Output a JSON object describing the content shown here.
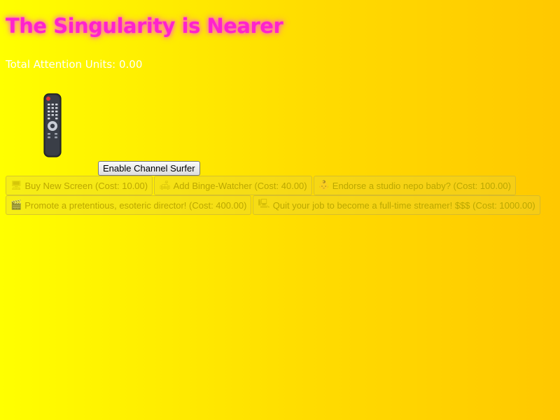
{
  "header": {
    "title": "The Singularity is Nearer",
    "score_text": "Total Attention Units: 0.00"
  },
  "clicker": {
    "icon": "tv-remote-icon"
  },
  "actions": {
    "channel_surfer_label": "Enable Channel Surfer"
  },
  "shop": {
    "row1": [
      {
        "icon": "screen-icon",
        "glyph": "🖥",
        "label": "Buy New Screen (Cost: 10.00)"
      },
      {
        "icon": "person-on-couch-icon",
        "glyph": "🛋",
        "label": "Add Binge-Watcher (Cost: 40.00)"
      },
      {
        "icon": "baby-icon",
        "glyph": "👶",
        "label": "Endorse a studio nepo baby? (Cost: 100.00)"
      }
    ],
    "row2": [
      {
        "icon": "clapperboard-icon",
        "glyph": "🎬",
        "label": "Promote a pretentious, esoteric director! (Cost: 400.00)"
      },
      {
        "icon": "monitor-icon",
        "glyph": "🖳",
        "label": "Quit your job to become a full-time streamer! $$$ (Cost: 1000.00)"
      }
    ]
  },
  "colors": {
    "title": "#ff22cc",
    "background_start": "#ffff00",
    "background_end": "#ffc800",
    "disabled_text": "#bba700"
  }
}
